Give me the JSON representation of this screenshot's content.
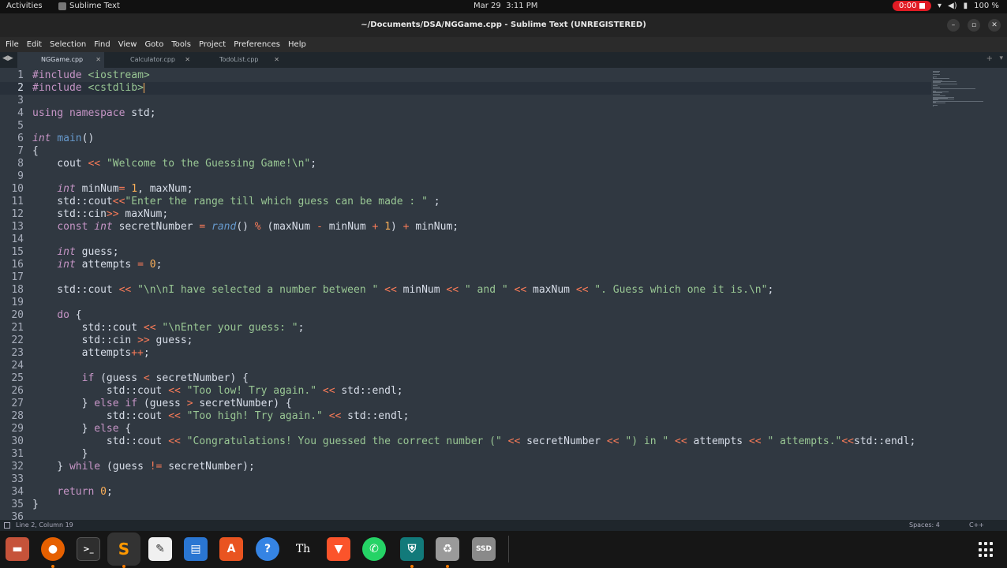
{
  "system_bar": {
    "activities": "Activities",
    "app_name": "Sublime Text",
    "date": "Mar 29",
    "time": "3:11 PM",
    "recording_time": "0:00",
    "battery": "100 %"
  },
  "window": {
    "title": "~/Documents/DSA/NGGame.cpp - Sublime Text (UNREGISTERED)"
  },
  "menu": [
    "File",
    "Edit",
    "Selection",
    "Find",
    "View",
    "Goto",
    "Tools",
    "Project",
    "Preferences",
    "Help"
  ],
  "tabs": [
    {
      "label": "NGGame.cpp",
      "active": true
    },
    {
      "label": "Calculator.cpp",
      "active": false
    },
    {
      "label": "TodoList.cpp",
      "active": false
    }
  ],
  "editor": {
    "current_line": 2,
    "lines": [
      [
        [
          "pre",
          "#include "
        ],
        [
          "str",
          "<iostream>"
        ]
      ],
      [
        [
          "pre",
          "#include "
        ],
        [
          "str",
          "<cstdlib>"
        ]
      ],
      [],
      [
        [
          "kw",
          "using"
        ],
        [
          "pl",
          " "
        ],
        [
          "kw",
          "namespace"
        ],
        [
          "pl",
          " std;"
        ]
      ],
      [],
      [
        [
          "type",
          "int"
        ],
        [
          "pl",
          " "
        ],
        [
          "fn",
          "main"
        ],
        [
          "pl",
          "()"
        ]
      ],
      [
        [
          "pl",
          "{"
        ]
      ],
      [
        [
          "pl",
          "    cout "
        ],
        [
          "op",
          "<<"
        ],
        [
          "pl",
          " "
        ],
        [
          "str",
          "\"Welcome to the Guessing Game!\\n\""
        ],
        [
          "pl",
          ";"
        ]
      ],
      [],
      [
        [
          "pl",
          "    "
        ],
        [
          "type",
          "int"
        ],
        [
          "pl",
          " minNum"
        ],
        [
          "op",
          "="
        ],
        [
          "pl",
          " "
        ],
        [
          "num",
          "1"
        ],
        [
          "pl",
          ", maxNum;"
        ]
      ],
      [
        [
          "pl",
          "    std::cout"
        ],
        [
          "op",
          "<<"
        ],
        [
          "str",
          "\"Enter the range till which guess can be made : \""
        ],
        [
          "pl",
          " ;"
        ]
      ],
      [
        [
          "pl",
          "    std::cin"
        ],
        [
          "op",
          ">>"
        ],
        [
          "pl",
          " maxNum;"
        ]
      ],
      [
        [
          "pl",
          "    "
        ],
        [
          "kw",
          "const"
        ],
        [
          "pl",
          " "
        ],
        [
          "type",
          "int"
        ],
        [
          "pl",
          " secretNumber "
        ],
        [
          "op",
          "="
        ],
        [
          "pl",
          " "
        ],
        [
          "fni",
          "rand"
        ],
        [
          "pl",
          "() "
        ],
        [
          "op",
          "%"
        ],
        [
          "pl",
          " (maxNum "
        ],
        [
          "op",
          "-"
        ],
        [
          "pl",
          " minNum "
        ],
        [
          "op",
          "+"
        ],
        [
          "pl",
          " "
        ],
        [
          "num",
          "1"
        ],
        [
          "pl",
          ") "
        ],
        [
          "op",
          "+"
        ],
        [
          "pl",
          " minNum;"
        ]
      ],
      [],
      [
        [
          "pl",
          "    "
        ],
        [
          "type",
          "int"
        ],
        [
          "pl",
          " guess;"
        ]
      ],
      [
        [
          "pl",
          "    "
        ],
        [
          "type",
          "int"
        ],
        [
          "pl",
          " attempts "
        ],
        [
          "op",
          "="
        ],
        [
          "pl",
          " "
        ],
        [
          "num",
          "0"
        ],
        [
          "pl",
          ";"
        ]
      ],
      [],
      [
        [
          "pl",
          "    std::cout "
        ],
        [
          "op",
          "<<"
        ],
        [
          "pl",
          " "
        ],
        [
          "str",
          "\"\\n\\nI have selected a number between \""
        ],
        [
          "pl",
          " "
        ],
        [
          "op",
          "<<"
        ],
        [
          "pl",
          " minNum "
        ],
        [
          "op",
          "<<"
        ],
        [
          "pl",
          " "
        ],
        [
          "str",
          "\" and \""
        ],
        [
          "pl",
          " "
        ],
        [
          "op",
          "<<"
        ],
        [
          "pl",
          " maxNum "
        ],
        [
          "op",
          "<<"
        ],
        [
          "pl",
          " "
        ],
        [
          "str",
          "\". Guess which one it is.\\n\""
        ],
        [
          "pl",
          ";"
        ]
      ],
      [],
      [
        [
          "pl",
          "    "
        ],
        [
          "kw",
          "do"
        ],
        [
          "pl",
          " {"
        ]
      ],
      [
        [
          "pl",
          "        std::cout "
        ],
        [
          "op",
          "<<"
        ],
        [
          "pl",
          " "
        ],
        [
          "str",
          "\"\\nEnter your guess: \""
        ],
        [
          "pl",
          ";"
        ]
      ],
      [
        [
          "pl",
          "        std::cin "
        ],
        [
          "op",
          ">>"
        ],
        [
          "pl",
          " guess;"
        ]
      ],
      [
        [
          "pl",
          "        attempts"
        ],
        [
          "op",
          "++"
        ],
        [
          "pl",
          ";"
        ]
      ],
      [],
      [
        [
          "pl",
          "        "
        ],
        [
          "kw",
          "if"
        ],
        [
          "pl",
          " (guess "
        ],
        [
          "op",
          "<"
        ],
        [
          "pl",
          " secretNumber) {"
        ]
      ],
      [
        [
          "pl",
          "            std::cout "
        ],
        [
          "op",
          "<<"
        ],
        [
          "pl",
          " "
        ],
        [
          "str",
          "\"Too low! Try again.\""
        ],
        [
          "pl",
          " "
        ],
        [
          "op",
          "<<"
        ],
        [
          "pl",
          " std::endl;"
        ]
      ],
      [
        [
          "pl",
          "        } "
        ],
        [
          "kw",
          "else"
        ],
        [
          "pl",
          " "
        ],
        [
          "kw",
          "if"
        ],
        [
          "pl",
          " (guess "
        ],
        [
          "op",
          ">"
        ],
        [
          "pl",
          " secretNumber) {"
        ]
      ],
      [
        [
          "pl",
          "            std::cout "
        ],
        [
          "op",
          "<<"
        ],
        [
          "pl",
          " "
        ],
        [
          "str",
          "\"Too high! Try again.\""
        ],
        [
          "pl",
          " "
        ],
        [
          "op",
          "<<"
        ],
        [
          "pl",
          " std::endl;"
        ]
      ],
      [
        [
          "pl",
          "        } "
        ],
        [
          "kw",
          "else"
        ],
        [
          "pl",
          " {"
        ]
      ],
      [
        [
          "pl",
          "            std::cout "
        ],
        [
          "op",
          "<<"
        ],
        [
          "pl",
          " "
        ],
        [
          "str",
          "\"Congratulations! You guessed the correct number (\""
        ],
        [
          "pl",
          " "
        ],
        [
          "op",
          "<<"
        ],
        [
          "pl",
          " secretNumber "
        ],
        [
          "op",
          "<<"
        ],
        [
          "pl",
          " "
        ],
        [
          "str",
          "\") in \""
        ],
        [
          "pl",
          " "
        ],
        [
          "op",
          "<<"
        ],
        [
          "pl",
          " attempts "
        ],
        [
          "op",
          "<<"
        ],
        [
          "pl",
          " "
        ],
        [
          "str",
          "\" attempts.\""
        ],
        [
          "op",
          "<<"
        ],
        [
          "pl",
          "std::endl;"
        ]
      ],
      [
        [
          "pl",
          "        }"
        ]
      ],
      [
        [
          "pl",
          "    } "
        ],
        [
          "kw",
          "while"
        ],
        [
          "pl",
          " (guess "
        ],
        [
          "op",
          "!="
        ],
        [
          "pl",
          " secretNumber);"
        ]
      ],
      [],
      [
        [
          "pl",
          "    "
        ],
        [
          "kw",
          "return"
        ],
        [
          "pl",
          " "
        ],
        [
          "num",
          "0"
        ],
        [
          "pl",
          ";"
        ]
      ],
      [
        [
          "pl",
          "}"
        ]
      ],
      []
    ]
  },
  "status": {
    "position": "Line 2, Column 19",
    "spaces": "Spaces: 4",
    "syntax": "C++"
  },
  "dock": [
    "files-icon",
    "firefox-icon",
    "terminal-icon",
    "sublime-text-icon",
    "text-editor-icon",
    "libreoffice-writer-icon",
    "app-center-icon",
    "help-icon",
    "typora-icon",
    "brave-icon",
    "whatsapp-icon",
    "vpn-icon",
    "trash-icon",
    "drive-icon"
  ],
  "colors": {
    "editor_bg": "#303841",
    "gutter_fg": "#a7adba",
    "keyword": "#c695c6",
    "string": "#99c794",
    "number": "#f9ae58",
    "operator": "#f97b58",
    "function": "#6699cc",
    "recording": "#e01b24"
  }
}
